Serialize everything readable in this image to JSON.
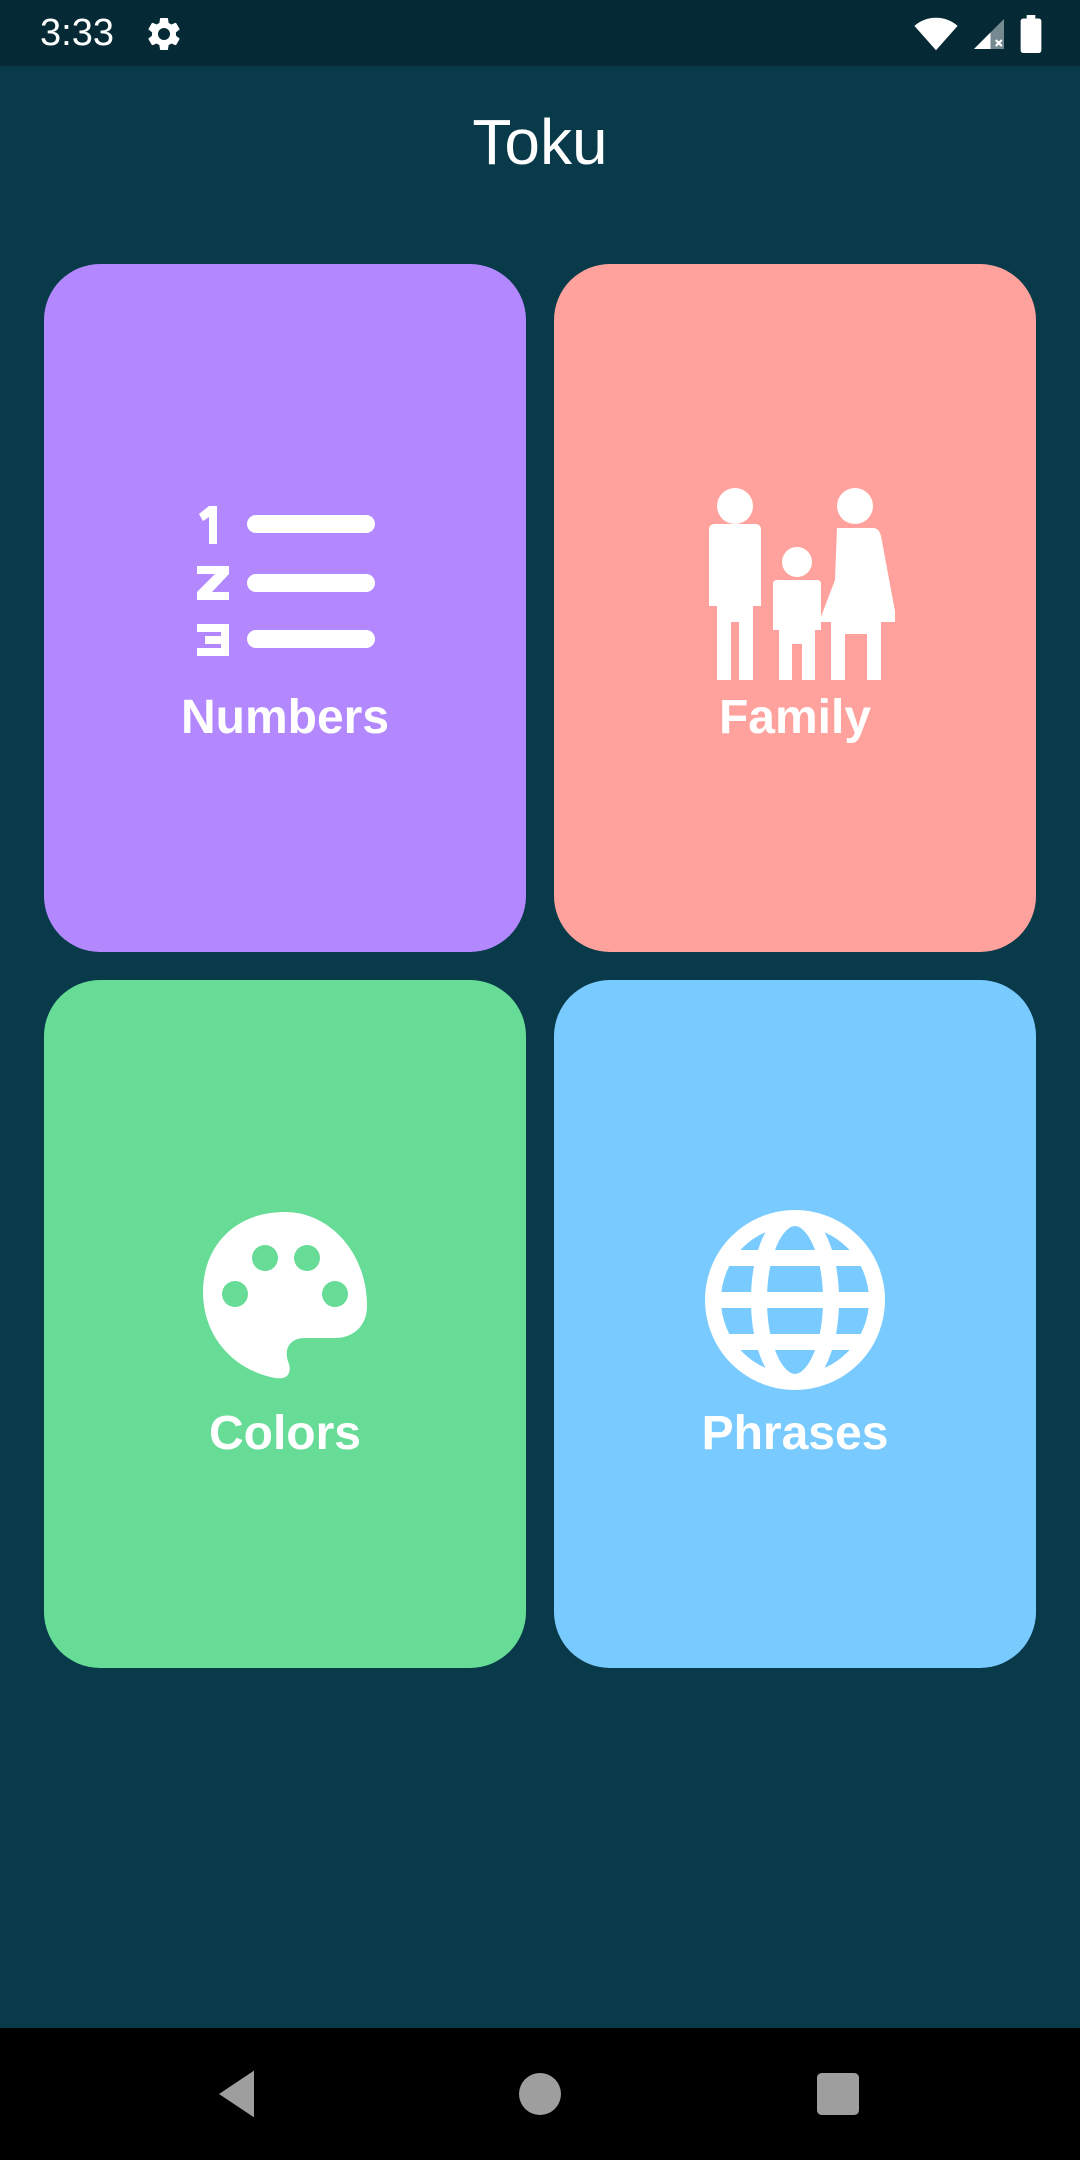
{
  "status_bar": {
    "time": "3:33",
    "icons": [
      "gear-icon",
      "wifi-icon",
      "signal-icon",
      "battery-icon"
    ]
  },
  "app": {
    "title": "Toku"
  },
  "categories": [
    {
      "label": "Numbers",
      "icon": "numbered-list-icon",
      "color": "#b388ff"
    },
    {
      "label": "Family",
      "icon": "family-icon",
      "color": "#ffa29d"
    },
    {
      "label": "Colors",
      "icon": "palette-icon",
      "color": "#67dc96"
    },
    {
      "label": "Phrases",
      "icon": "globe-icon",
      "color": "#79cbff"
    }
  ],
  "navigation": {
    "buttons": [
      "back-icon",
      "home-icon",
      "recents-icon"
    ]
  },
  "colors": {
    "background": "#083a4a",
    "status_bar": "#052a35",
    "nav_bar": "#000000"
  }
}
